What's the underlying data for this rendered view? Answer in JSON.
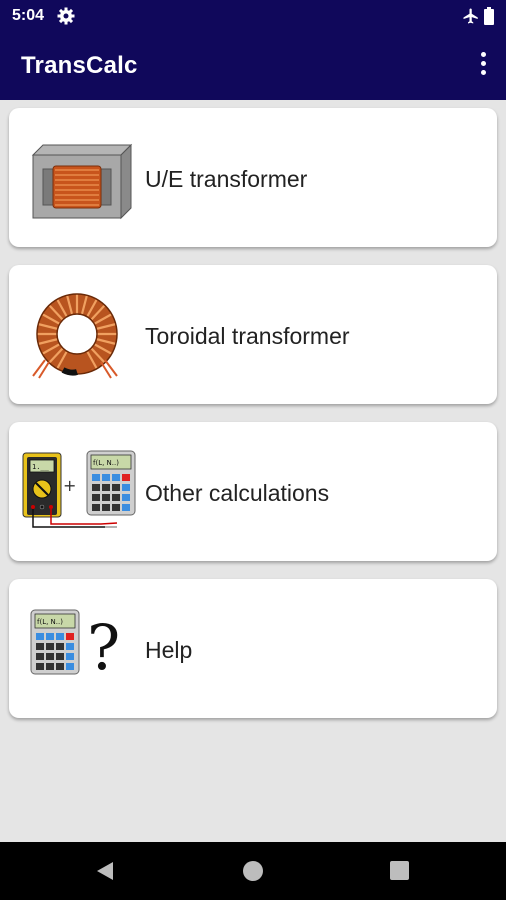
{
  "status_bar": {
    "time": "5:04"
  },
  "app_bar": {
    "title": "TransCalc"
  },
  "menu": [
    {
      "label": "U/E transformer",
      "icon": "ue-transformer-icon"
    },
    {
      "label": "Toroidal transformer",
      "icon": "toroidal-transformer-icon"
    },
    {
      "label": "Other calculations",
      "icon": "multimeter-calculator-icon"
    },
    {
      "label": "Help",
      "icon": "calculator-question-icon"
    }
  ],
  "calculator_display": "f(L, N..)",
  "multimeter_display": "1.__",
  "help_glyph": "?",
  "plus_glyph": "+",
  "colors": {
    "primary": "#10085b",
    "background": "#e5e5e5",
    "card": "#ffffff"
  }
}
